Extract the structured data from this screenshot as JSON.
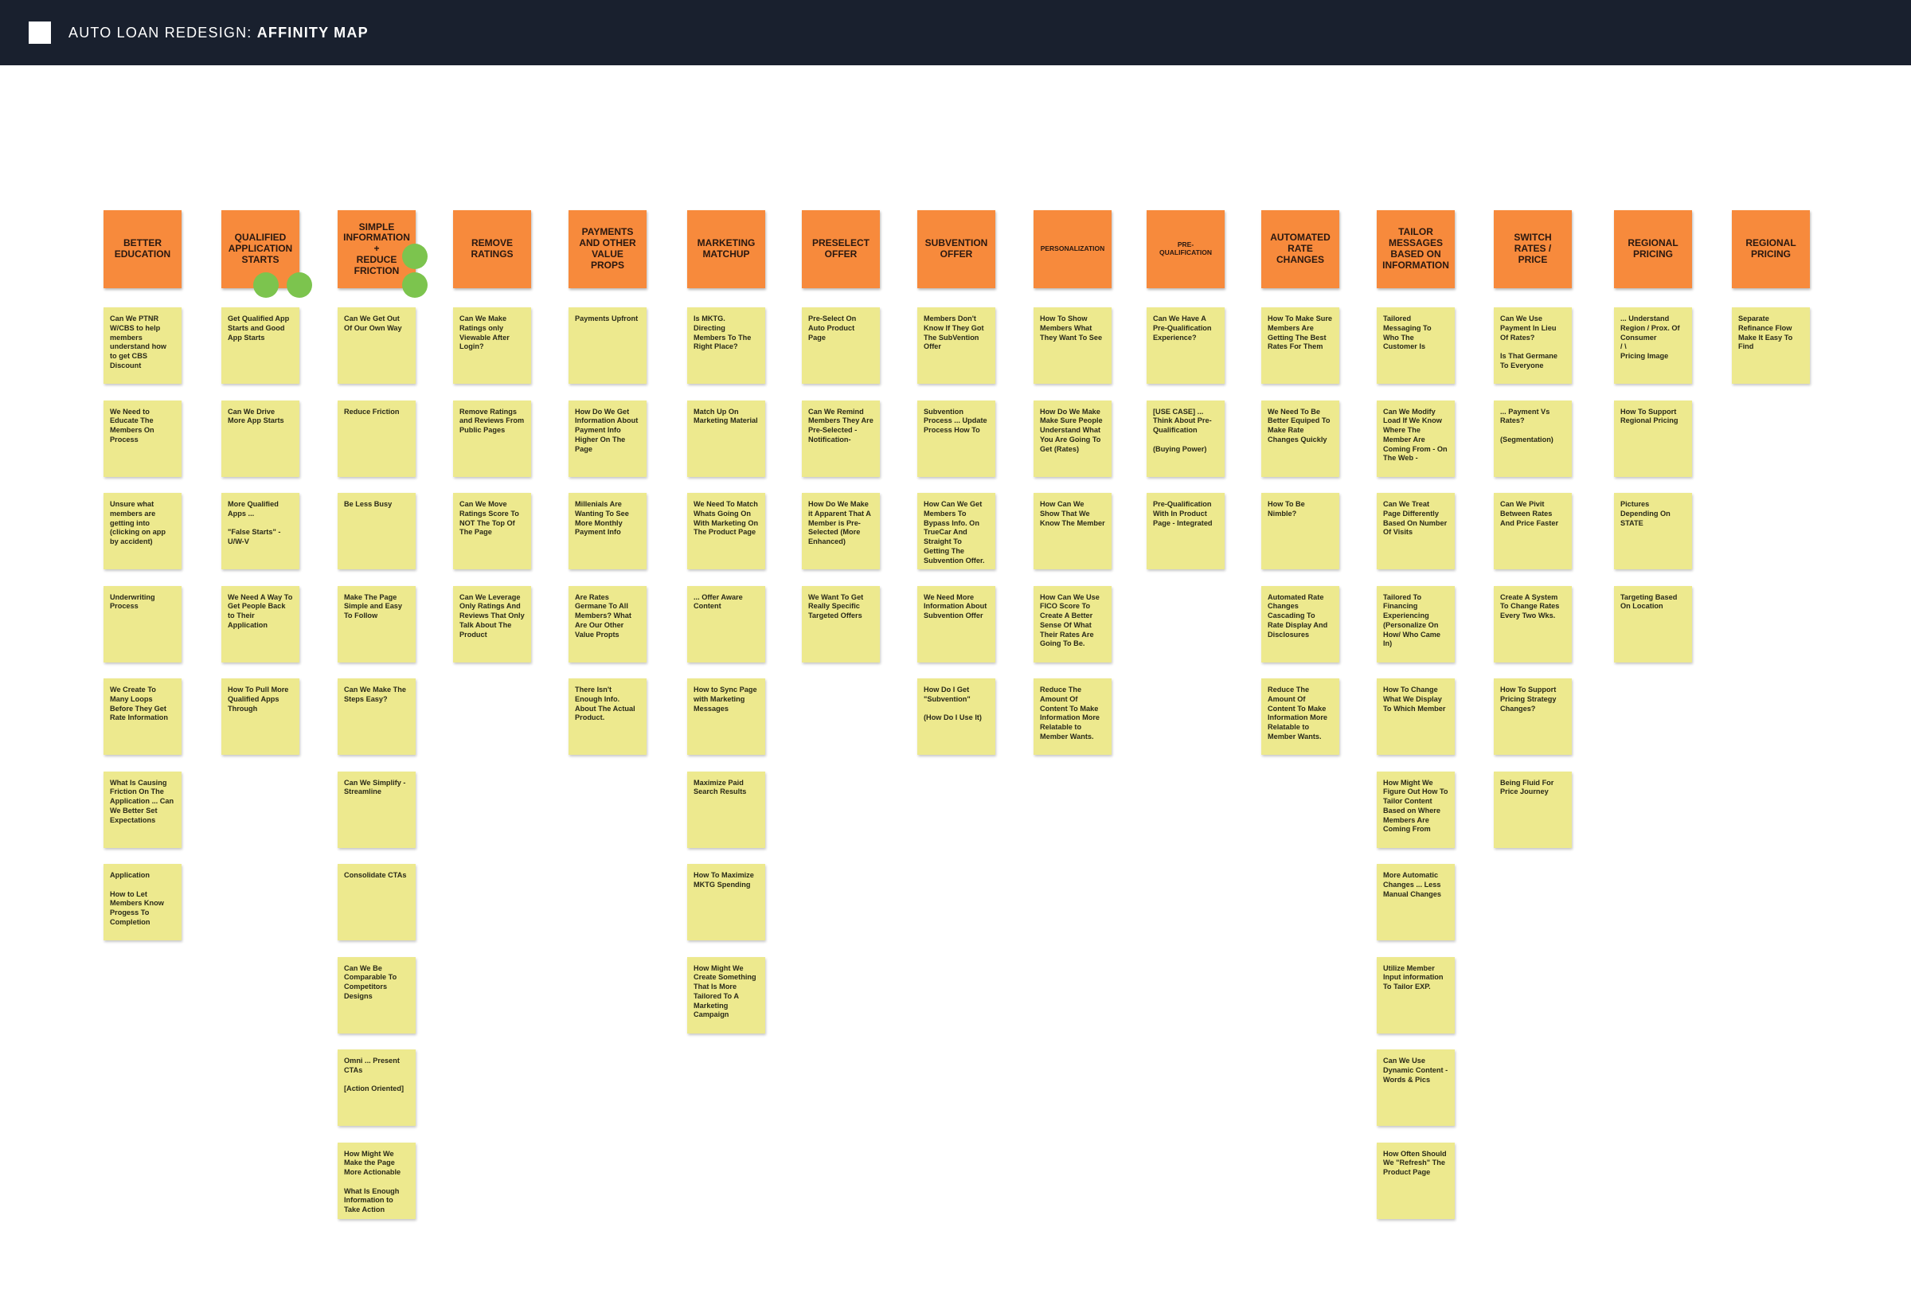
{
  "app": {
    "title_prefix": "AUTO LOAN REDESIGN: ",
    "title_emphasis": "AFFINITY MAP"
  },
  "columns": [
    {
      "header": "Better\nEducation",
      "notes": [
        "Can We PTNR W/CBS to help members understand how to get CBS Discount",
        "We Need to Educate The Members On Process",
        "Unsure what members are getting into (clicking on app by accident)",
        "Underwriting Process",
        "We Create To Many Loops Before They Get Rate Information",
        "What Is Causing Friction On The Application ... Can We Better Set Expectations",
        "Application\n\nHow to Let Members Know Progess To Completion"
      ]
    },
    {
      "header": "Qualified\nApplication\nStarts",
      "notes": [
        "Get Qualified App Starts and Good App Starts",
        "Can We Drive More App Starts",
        "More Qualified Apps ...\n\n\"False Starts\" -U/W-V",
        "We Need A Way To Get People Back to Their Application",
        "How To Pull More Qualified Apps Through"
      ]
    },
    {
      "header": "Simple\nInformation\n+\nReduce\nFriction",
      "notes": [
        "Can We Get Out Of Our Own Way",
        "Reduce Friction",
        "Be Less Busy",
        "Make The Page Simple and Easy To Follow",
        "Can We Make The Steps Easy?",
        "Can We Simplify - Streamline",
        "Consolidate CTAs",
        "Can We Be Comparable To Competitors Designs",
        "Omni ... Present CTAs\n\n[Action Oriented]",
        "How Might We Make the Page More Actionable\n\nWhat Is Enough Information to Take Action"
      ]
    },
    {
      "header": "Remove\nRatings",
      "notes": [
        "Can We Make Ratings only Viewable After Login?",
        "Remove Ratings and Reviews From Public Pages",
        "Can We Move Ratings Score To NOT The Top Of The Page",
        "Can We Leverage Only Ratings And Reviews That Only Talk About The Product"
      ]
    },
    {
      "header": "Payments\nand Other\nValue\nProps",
      "notes": [
        "Payments Upfront",
        "How Do We Get Information About Payment Info Higher On The Page",
        "Millenials Are Wanting To See More Monthly Payment Info",
        "Are Rates Germane To All Members? What Are Our Other Value Propts",
        "There Isn't Enough Info. About The Actual Product."
      ]
    },
    {
      "header": "Marketing\nMatchup",
      "notes": [
        "Is MKTG. Directing Members To The Right Place?",
        "Match Up On Marketing Material",
        "We Need To Match Whats Going On With Marketing On The Product Page",
        "... Offer Aware Content",
        "How to Sync Page with Marketing Messages",
        "Maximize Paid Search Results",
        "How To Maximize MKTG Spending",
        "How Might We Create Something That Is More Tailored To A Marketing Campaign"
      ]
    },
    {
      "header": "Preselect\nOffer",
      "notes": [
        "Pre-Select On Auto Product Page",
        "Can We Remind Members They Are Pre-Selected -Notification-",
        "How Do We Make it Apparent That A Member is Pre-Selected (More Enhanced)",
        "We Want To Get Really Specific Targeted Offers"
      ]
    },
    {
      "header": "Subvention\nOffer",
      "notes": [
        "Members Don't Know If They Got The SubVention Offer",
        "Subvention Process ... Update Process How To",
        "How Can We Get Members To Bypass Info. On TrueCar And Straight To Getting The Subvention Offer.",
        "We Need More Information About Subvention Offer",
        "How Do I Get \"Subvention\"\n\n(How Do I Use It)"
      ]
    },
    {
      "header": "Personalization",
      "small": true,
      "notes": [
        "How To Show Members What They Want To See",
        "How Do We Make Make Sure People Understand What You Are Going To Get (Rates)",
        "How Can We Show That We Know The Member",
        "How Can We Use FICO Score To Create A Better Sense Of What Their Rates Are Going To Be.",
        "Reduce The Amount Of Content To Make Information More Relatable to Member Wants."
      ]
    },
    {
      "header": "Pre-Qualification",
      "small": true,
      "notes": [
        "Can We Have A Pre-Qualification Experience?",
        "[USE CASE] ... Think About Pre-Qualification\n\n(Buying Power)",
        "Pre-Qualification With In Product Page - Integrated"
      ]
    },
    {
      "header": "Automated\nRate Changes",
      "notes": [
        "How To Make Sure Members Are Getting The Best Rates For Them",
        "We Need To Be Better Equiped To Make Rate Changes Quickly",
        "How To Be Nimble?",
        "Automated Rate Changes Cascading To Rate Display And Disclosures",
        "Reduce The Amount Of Content To Make Information More Relatable to Member Wants."
      ]
    },
    {
      "header": "Tailor\nMessages\nBased on\nInformation",
      "notes": [
        "Tailored Messaging To Who The Customer Is",
        "Can We Modify Load If We Know Where The Member Are Coming From - On The Web -",
        "Can We Treat Page Differently Based On Number Of Visits",
        "Tailored To Financing Experiencing (Personalize On How/ Who Came In)",
        "How To Change What We Display To Which Member",
        "How Might We Figure Out How To Tailor Content Based on Where Members Are Coming From",
        "More Automatic Changes ... Less Manual Changes",
        "Utilize Member Input information To Tailor EXP.",
        "Can We Use Dynamic Content - Words & Pics",
        "How Often Should We \"Refresh\" The Product Page"
      ]
    },
    {
      "header": "Switch\nRates / Price",
      "notes": [
        "Can We Use Payment In Lieu Of Rates?\n\nIs That Germane To Everyone",
        "... Payment Vs Rates?\n\n(Segmentation)",
        "Can We Pivit Between Rates And Price Faster",
        "Create A System To Change Rates Every Two Wks.",
        "How To Support Pricing Strategy Changes?",
        "Being Fluid For Price Journey"
      ]
    },
    {
      "header": "Regional\nPricing",
      "notes": [
        "... Understand Region / Prox. Of Consumer\n      /      \\\nPricing    Image",
        "How To Support Regional Pricing",
        "Pictures Depending On STATE",
        "Targeting Based On Location"
      ]
    },
    {
      "header": "Regional\nPricing",
      "notes": [
        "Separate Refinance Flow Make It Easy To Find"
      ]
    }
  ],
  "colors": {
    "topbar": "#19202e",
    "header_note": "#f78a3c",
    "sticky_note": "#ede98e",
    "vote_dot": "#7cc44e"
  }
}
